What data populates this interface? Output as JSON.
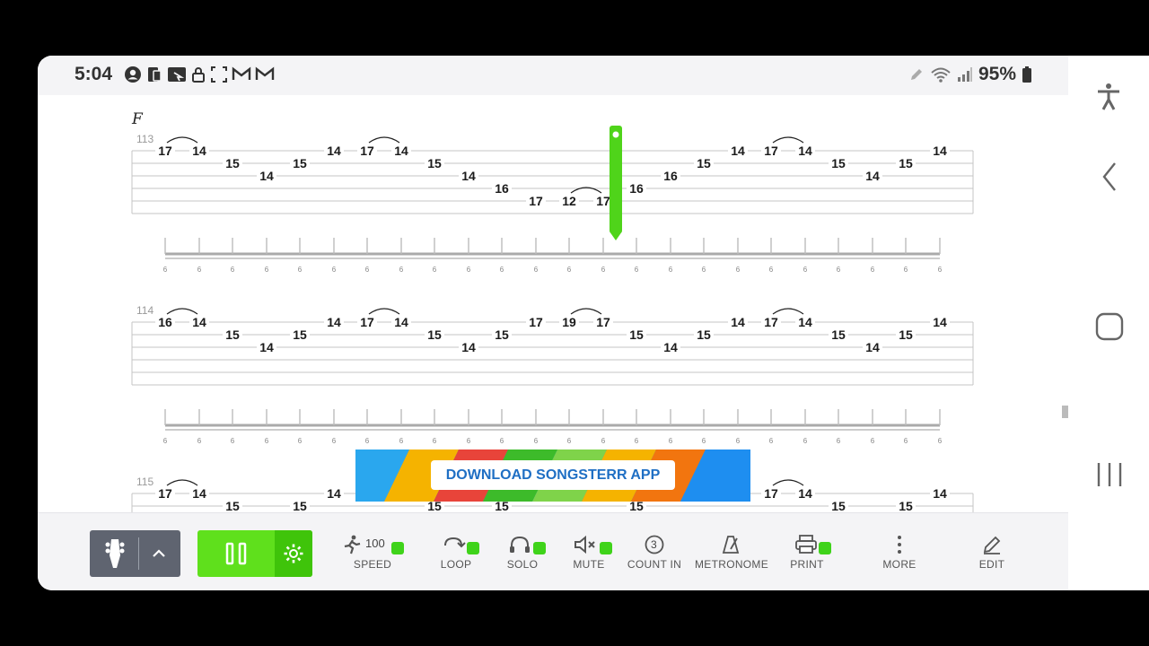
{
  "status": {
    "time": "5:04",
    "battery": "95%"
  },
  "score": {
    "section": "F",
    "systems": [
      {
        "measure": "113",
        "notes": [
          "17",
          "14",
          "15",
          "14",
          "15",
          "14",
          "17",
          "14",
          "15",
          "14",
          "16",
          "17",
          "12",
          "17",
          "16",
          "16",
          "15",
          "14",
          "17",
          "14",
          "15",
          "14",
          "15",
          "14"
        ]
      },
      {
        "measure": "114",
        "notes": [
          "16",
          "14",
          "15",
          "14",
          "15",
          "14",
          "17",
          "14",
          "15",
          "14",
          "15",
          "17",
          "19",
          "17",
          "15",
          "14",
          "15",
          "14",
          "17",
          "14",
          "15",
          "14",
          "15",
          "14"
        ]
      },
      {
        "measure": "115",
        "notes": [
          "17",
          "14",
          "15",
          "15",
          "14",
          "15",
          "15",
          "15",
          "17",
          "14",
          "15",
          "15",
          "14"
        ]
      }
    ],
    "rhythm_label": "6"
  },
  "banner": {
    "label": "DOWNLOAD SONGSTERR APP"
  },
  "toolbar": {
    "speed_value": "100",
    "speed": "SPEED",
    "loop": "LOOP",
    "solo": "SOLO",
    "mute": "MUTE",
    "count_in_value": "3",
    "count_in": "COUNT IN",
    "metronome": "METRONOME",
    "print": "PRINT",
    "more": "MORE",
    "edit": "EDIT"
  },
  "colors": {
    "accent": "#5fe01c",
    "accent_dark": "#3fc40a",
    "cursor": "#4fd41a",
    "tuner": "#5f6470",
    "link": "#1f6fc4"
  }
}
